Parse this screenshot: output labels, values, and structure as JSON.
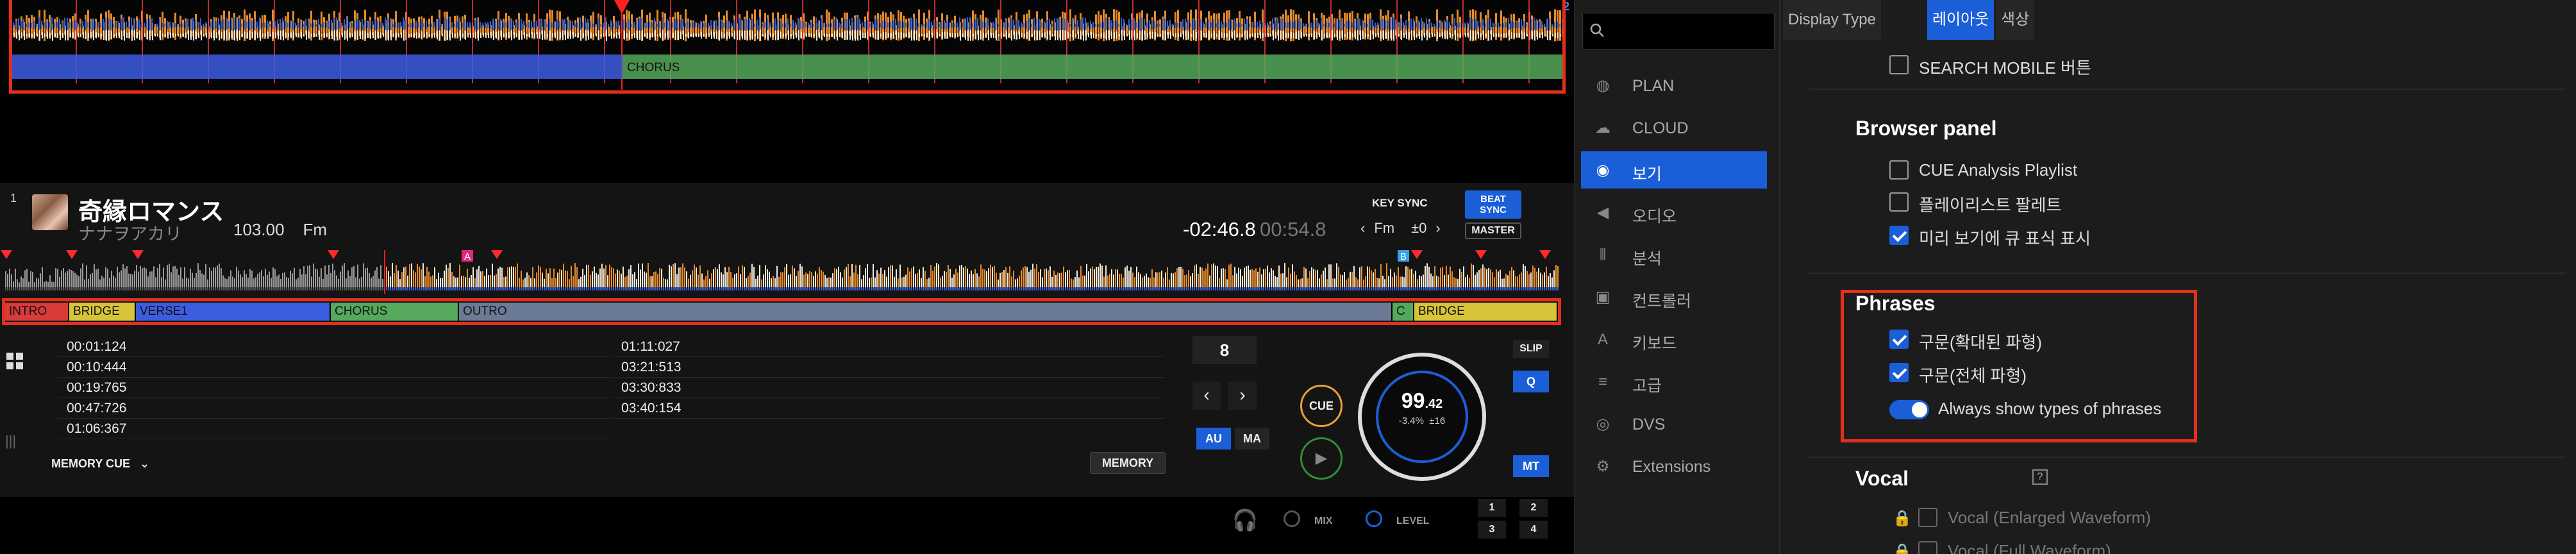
{
  "deck": {
    "number": "1",
    "title": "奇縁ロマンス",
    "artist": "ナナヲアカリ",
    "bpm": "103.00",
    "bpm_key": "Fm",
    "time_remaining": "-02:46.8",
    "time_elapsed": "00:54.8",
    "key_sync_label": "KEY SYNC",
    "key_value": "Fm",
    "key_offset": "±0",
    "key_left_arrow": "‹",
    "key_right_arrow": "›",
    "beat_sync_label": "BEAT SYNC",
    "master_label": "MASTER",
    "enlarged_phrase_label": "CHORUS",
    "phrases": [
      {
        "label": "INTRO",
        "color": "#d93a3a"
      },
      {
        "label": "BRIDGE",
        "color": "#d8c43a"
      },
      {
        "label": "VERSE1",
        "color": "#3d5de0"
      },
      {
        "label": "CHORUS",
        "color": "#56a85c"
      },
      {
        "label": "OUTRO",
        "color": "#6b7a95"
      },
      {
        "label": "C",
        "color": "#56a85c"
      },
      {
        "label": "BRIDGE",
        "color": "#d8c43a"
      }
    ],
    "hot_cue_badges": [
      "A",
      "B"
    ],
    "cue_list_left": [
      "00:01:124",
      "00:10:444",
      "00:19:765",
      "00:47:726",
      "01:06:367"
    ],
    "cue_list_right": [
      "01:11:027",
      "03:21:513",
      "03:30:833",
      "03:40:154"
    ],
    "memory_cue_label": "MEMORY CUE",
    "memory_button": "MEMORY",
    "beat_jump_value": "8",
    "auto_label": "AU",
    "manual_label": "MA",
    "cue_label": "CUE",
    "play_symbol": "▶",
    "jog_bpm_int": "99",
    "jog_bpm_dec": ".42",
    "jog_pitch": "-3.4%",
    "jog_range": "±16",
    "slip_label": "SLIP",
    "quantize_label": "Q",
    "mt_label": "MT",
    "mix_label": "MIX",
    "level_label": "LEVEL",
    "num_buttons": [
      "1",
      "2",
      "3",
      "4"
    ],
    "corner_number": "2"
  },
  "sidebar": {
    "search_placeholder": "",
    "items": [
      {
        "label": "PLAN",
        "icon": "globe-icon"
      },
      {
        "label": "CLOUD",
        "icon": "cloud-icon"
      },
      {
        "label": "보기",
        "icon": "eye-icon",
        "active": true
      },
      {
        "label": "오디오",
        "icon": "speaker-icon"
      },
      {
        "label": "분석",
        "icon": "waveform-icon"
      },
      {
        "label": "컨트롤러",
        "icon": "controller-icon"
      },
      {
        "label": "키보드",
        "icon": "keyboard-icon"
      },
      {
        "label": "고급",
        "icon": "list-icon"
      },
      {
        "label": "DVS",
        "icon": "vinyl-icon"
      },
      {
        "label": "Extensions",
        "icon": "gears-icon"
      }
    ]
  },
  "tabs": [
    {
      "label": "Display Type",
      "active": false
    },
    {
      "label": "레이아웃",
      "active": true
    },
    {
      "label": "색상",
      "active": false
    }
  ],
  "settings": {
    "search_mobile": {
      "label": "SEARCH MOBILE 버튼",
      "checked": false
    },
    "browser_panel": {
      "title": "Browser panel",
      "items": [
        {
          "label": "CUE Analysis Playlist",
          "checked": false
        },
        {
          "label": "플레이리스트 팔레트",
          "checked": false
        },
        {
          "label": "미리 보기에 큐 표식 표시",
          "checked": true
        }
      ]
    },
    "phrases": {
      "title": "Phrases",
      "items": [
        {
          "label": "구문(확대된 파형)",
          "checked": true
        },
        {
          "label": "구문(전체 파형)",
          "checked": true
        }
      ],
      "toggle": {
        "label": "Always show types of phrases",
        "on": true
      }
    },
    "vocal": {
      "title": "Vocal",
      "help": "?",
      "items": [
        {
          "label": "Vocal (Enlarged Waveform)",
          "checked": false,
          "locked": true
        },
        {
          "label": "Vocal (Full Waveform)",
          "checked": false,
          "locked": true
        }
      ]
    }
  },
  "colors": {
    "accent": "#1b5fd8",
    "highlight_box": "#e2301d",
    "waveform_orange": "#e48a2a",
    "waveform_blue": "#2f5fd0",
    "waveform_white": "#f3ead8"
  }
}
